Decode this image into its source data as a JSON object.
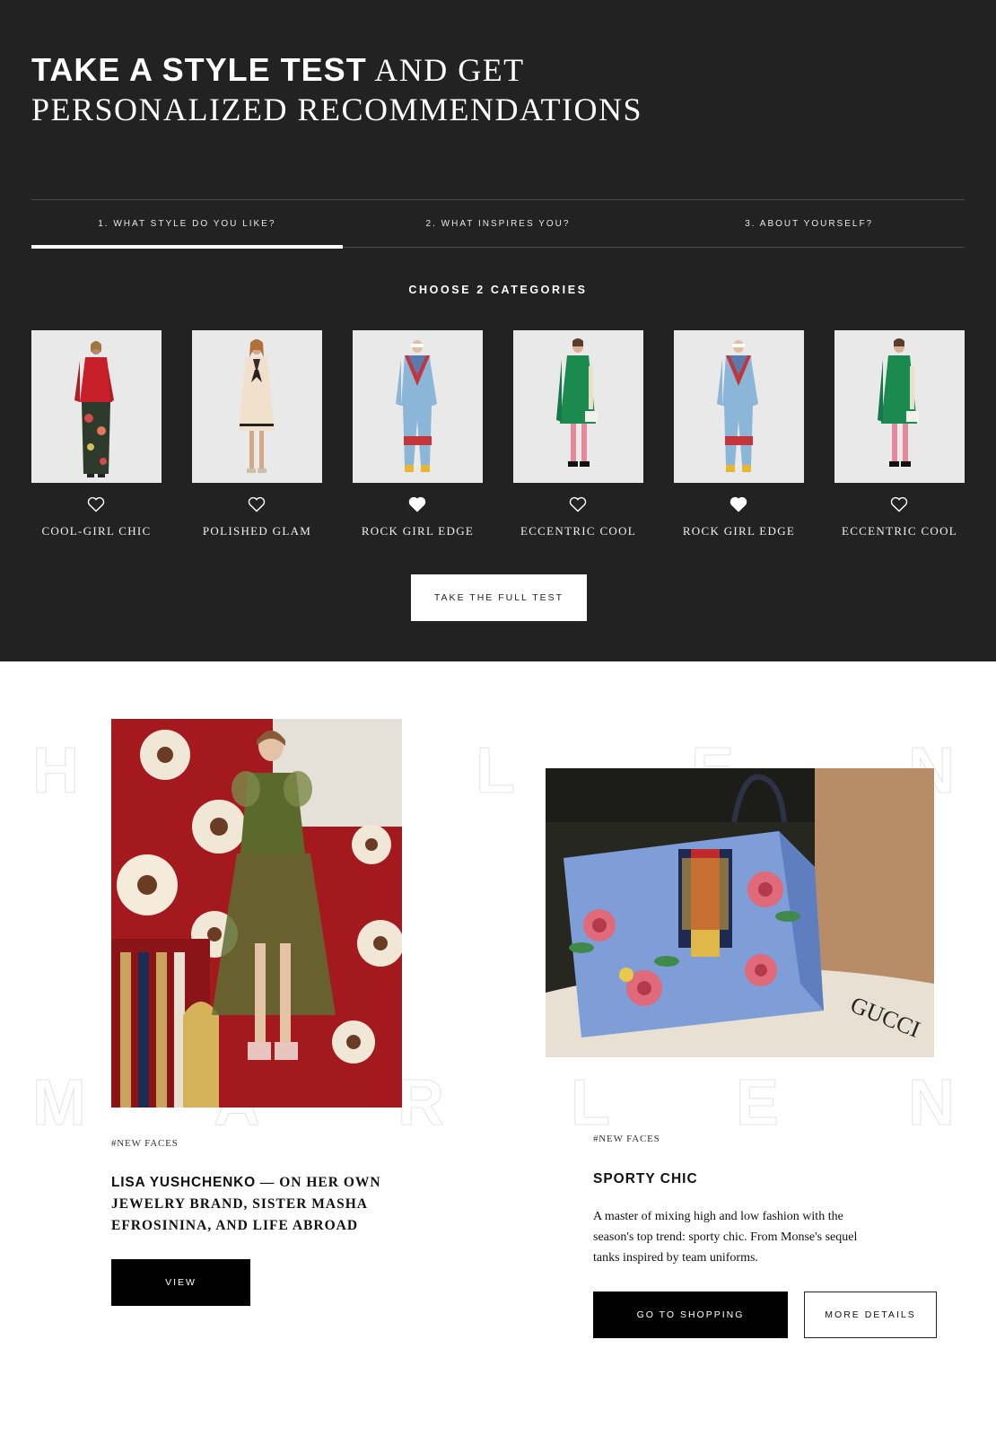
{
  "hero": {
    "title_bold": "TAKE A STYLE TEST",
    "title_rest": " AND GET PERSONALIZED RECOMMENDATIONS"
  },
  "steps": [
    {
      "label": "1. WHAT STYLE DO YOU LIKE?",
      "active": true
    },
    {
      "label": "2. WHAT INSPIRES YOU?",
      "active": false
    },
    {
      "label": "3. ABOUT YOURSELF?",
      "active": false
    }
  ],
  "choose_label": "CHOOSE 2 CATEGORIES",
  "categories": [
    {
      "label": "COOL-GIRL CHIC",
      "liked": false,
      "outfit": "red-jacket-floral"
    },
    {
      "label": "POLISHED GLAM",
      "liked": false,
      "outfit": "cream-dress"
    },
    {
      "label": "ROCK GIRL EDGE",
      "liked": true,
      "outfit": "blue-tracksuit"
    },
    {
      "label": "ECCENTRIC COOL",
      "liked": false,
      "outfit": "green-dress"
    },
    {
      "label": "ROCK GIRL EDGE",
      "liked": true,
      "outfit": "blue-tracksuit"
    },
    {
      "label": "ECCENTRIC COOL",
      "liked": false,
      "outfit": "green-dress"
    }
  ],
  "full_test_label": "TAKE THE FULL TEST",
  "background_letters": [
    "H",
    "L",
    "E",
    "N",
    "M",
    "A",
    "R",
    "L",
    "E",
    "N"
  ],
  "story_left": {
    "tag": "#NEW FACES",
    "title_bold": "LISA YUSHCHENKO",
    "title_rest": " — ON HER OWN JEWELRY BRAND, SISTER MASHA EFROSININA, AND LIFE ABROAD",
    "button": "VIEW",
    "image": "model-green-dress-floral-background"
  },
  "story_right": {
    "tag": "#NEW FACES",
    "title": "SPORTY CHIC",
    "description": "A master of mixing high and low fashion with the season's top trend: sporty chic. From Monse's sequel tanks inspired by team uniforms.",
    "primary_button": "GO TO SHOPPING",
    "secondary_button": "MORE DETAILS",
    "image": "blue-floral-handbag",
    "bag_text": "GUCCI"
  },
  "colors": {
    "dark_bg": "#222223",
    "white": "#ffffff",
    "black": "#000000"
  }
}
